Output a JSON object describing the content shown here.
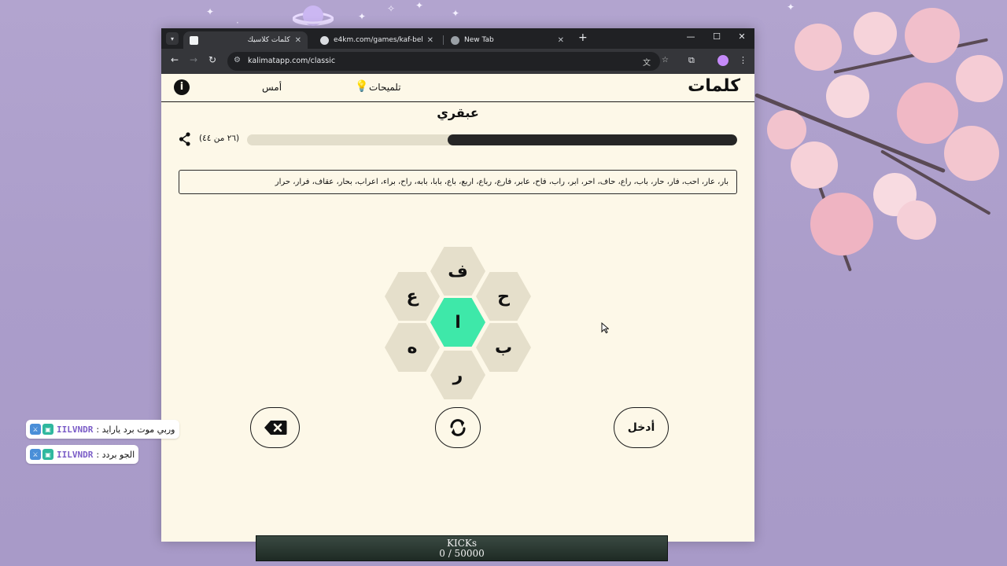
{
  "browser": {
    "tabs": [
      {
        "title": "كلمات كلاسيك",
        "active": true
      },
      {
        "title": "e4km.com/games/kaf-bekaf",
        "active": false
      },
      {
        "title": "New Tab",
        "active": false
      }
    ],
    "url": "kalimatapp.com/classic"
  },
  "header": {
    "logo": "كلمات",
    "hints_label": "تلميحات",
    "yesterday_label": "أمس",
    "info_icon": "i"
  },
  "game": {
    "rank": "عبقري",
    "score_text": "(٢٦ من ٤٤)",
    "progress_found": 26,
    "progress_total": 44,
    "found_words": "بار، عار، احب، فار، حار، باب، راع، حاف، احر، ابر، راب، فاح، عابر، فارع، رباع، اربع، باع، بابا، بابه، راح، براء، اعراب، بحار، عقاف، فرار، حرار",
    "letters": {
      "center": "ا",
      "top": "ف",
      "upper_left": "ع",
      "upper_right": "ح",
      "lower_left": "ه",
      "lower_right": "ب",
      "bottom": "ر"
    },
    "enter_label": "أدخل"
  },
  "chat": [
    {
      "user": "IILVNDR",
      "text": "وربي موت برد يارايد"
    },
    {
      "user": "IILVNDR",
      "text": "الجو بردد"
    }
  ],
  "kicks": {
    "label": "KICKs",
    "count": "0 / 50000"
  }
}
